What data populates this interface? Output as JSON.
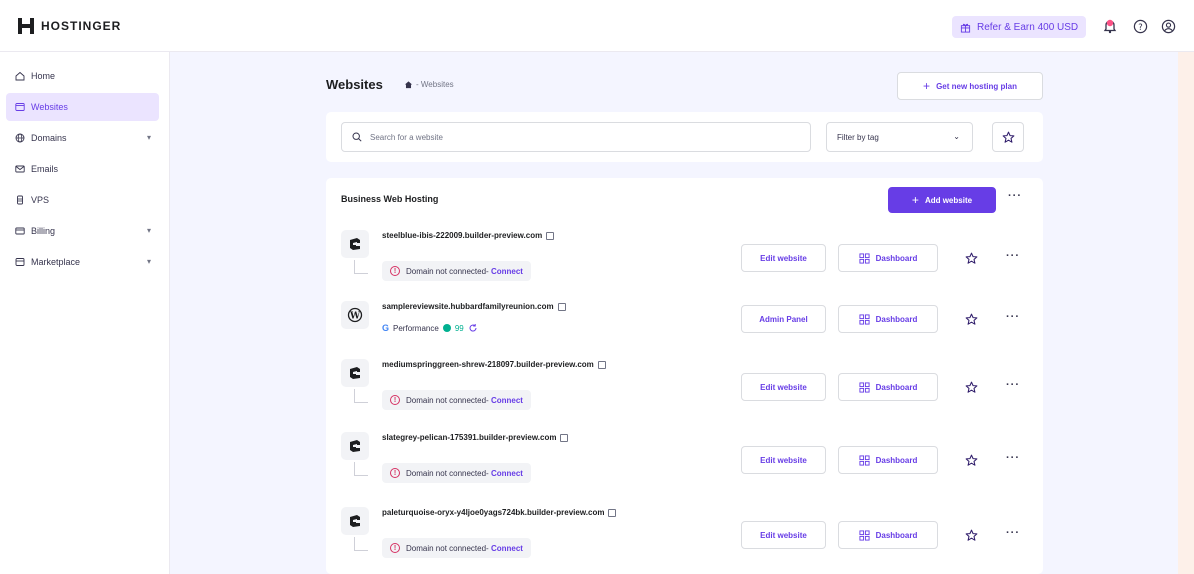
{
  "brand": {
    "name": "HOSTINGER"
  },
  "topbar": {
    "refer_label": "Refer & Earn 400 USD"
  },
  "sidebar": {
    "items": [
      {
        "label": "Home",
        "icon": "home-icon"
      },
      {
        "label": "Websites",
        "icon": "browser-icon",
        "active": true
      },
      {
        "label": "Domains",
        "icon": "globe-icon",
        "expandable": true
      },
      {
        "label": "Emails",
        "icon": "mail-icon"
      },
      {
        "label": "VPS",
        "icon": "server-icon"
      },
      {
        "label": "Billing",
        "icon": "card-icon",
        "expandable": true
      },
      {
        "label": "Marketplace",
        "icon": "store-icon",
        "expandable": true
      }
    ]
  },
  "header": {
    "title": "Websites",
    "breadcrumb": "- Websites",
    "new_plan_label": "Get new hosting plan"
  },
  "search": {
    "placeholder": "Search for a website",
    "filter_label": "Filter by tag"
  },
  "hosting": {
    "title": "Business Web Hosting",
    "add_label": "Add website",
    "dashboard_label": "Dashboard",
    "sites": [
      {
        "name": "steelblue-ibis-222009.builder-preview.com",
        "type": "builder",
        "status": "Domain not connected-",
        "connect": "Connect",
        "action": "Edit website"
      },
      {
        "name": "samplereviewsite.hubbardfamilyreunion.com",
        "type": "wordpress",
        "performance_label": "Performance",
        "performance_score": "99",
        "action": "Admin Panel"
      },
      {
        "name": "mediumspringgreen-shrew-218097.builder-preview.com",
        "type": "builder",
        "status": "Domain not connected-",
        "connect": "Connect",
        "action": "Edit website"
      },
      {
        "name": "slategrey-pelican-175391.builder-preview.com",
        "type": "builder",
        "status": "Domain not connected-",
        "connect": "Connect",
        "action": "Edit website"
      },
      {
        "name": "paleturquoise-oryx-y4ljoe0yags724bk.builder-preview.com",
        "type": "builder",
        "status": "Domain not connected-",
        "connect": "Connect",
        "action": "Edit website"
      }
    ]
  }
}
